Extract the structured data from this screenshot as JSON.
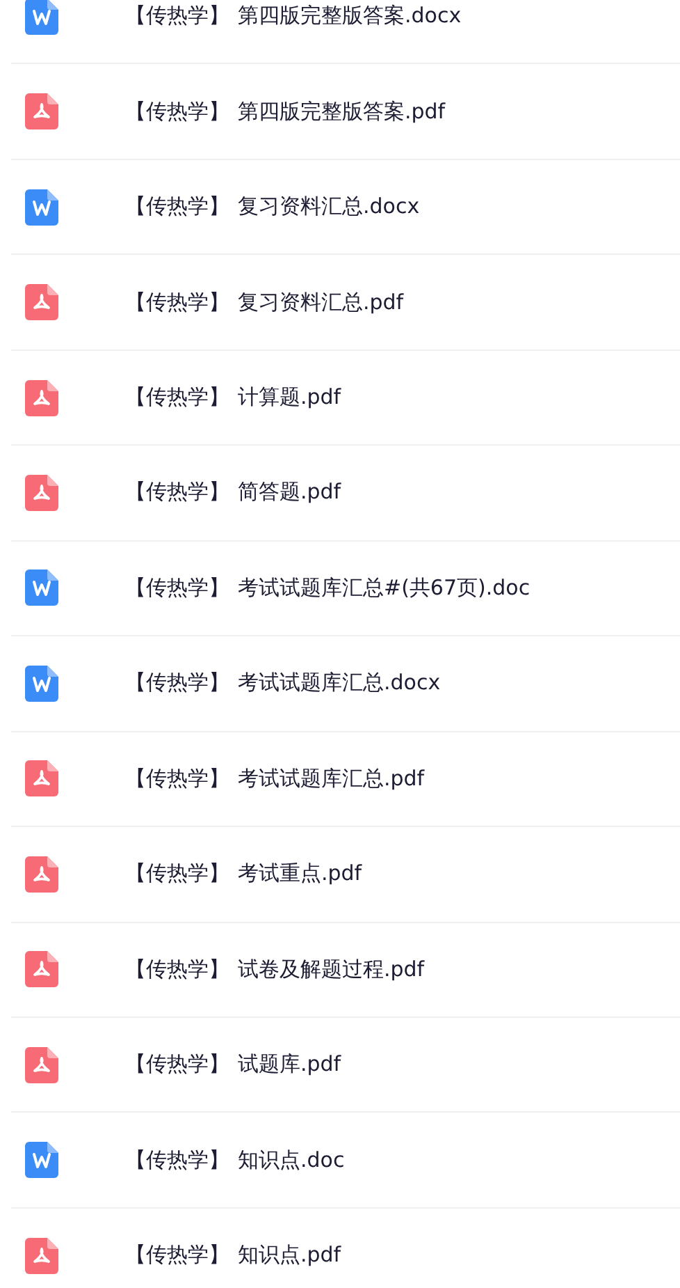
{
  "files": [
    {
      "kind": "word",
      "tag": "【传热学】",
      "name": "第四版完整版答案.docx"
    },
    {
      "kind": "pdf",
      "tag": "【传热学】",
      "name": "第四版完整版答案.pdf"
    },
    {
      "kind": "word",
      "tag": "【传热学】",
      "name": "复习资料汇总.docx"
    },
    {
      "kind": "pdf",
      "tag": "【传热学】",
      "name": "复习资料汇总.pdf"
    },
    {
      "kind": "pdf",
      "tag": "【传热学】",
      "name": "计算题.pdf"
    },
    {
      "kind": "pdf",
      "tag": "【传热学】",
      "name": "简答题.pdf"
    },
    {
      "kind": "word",
      "tag": "【传热学】",
      "name": "考试试题库汇总#(共67页).doc"
    },
    {
      "kind": "word",
      "tag": "【传热学】",
      "name": "考试试题库汇总.docx"
    },
    {
      "kind": "pdf",
      "tag": "【传热学】",
      "name": "考试试题库汇总.pdf"
    },
    {
      "kind": "pdf",
      "tag": "【传热学】",
      "name": "考试重点.pdf"
    },
    {
      "kind": "pdf",
      "tag": "【传热学】",
      "name": "试卷及解题过程.pdf"
    },
    {
      "kind": "pdf",
      "tag": "【传热学】",
      "name": "试题库.pdf"
    },
    {
      "kind": "word",
      "tag": "【传热学】",
      "name": "知识点.doc"
    },
    {
      "kind": "pdf",
      "tag": "【传热学】",
      "name": "知识点.pdf"
    }
  ]
}
